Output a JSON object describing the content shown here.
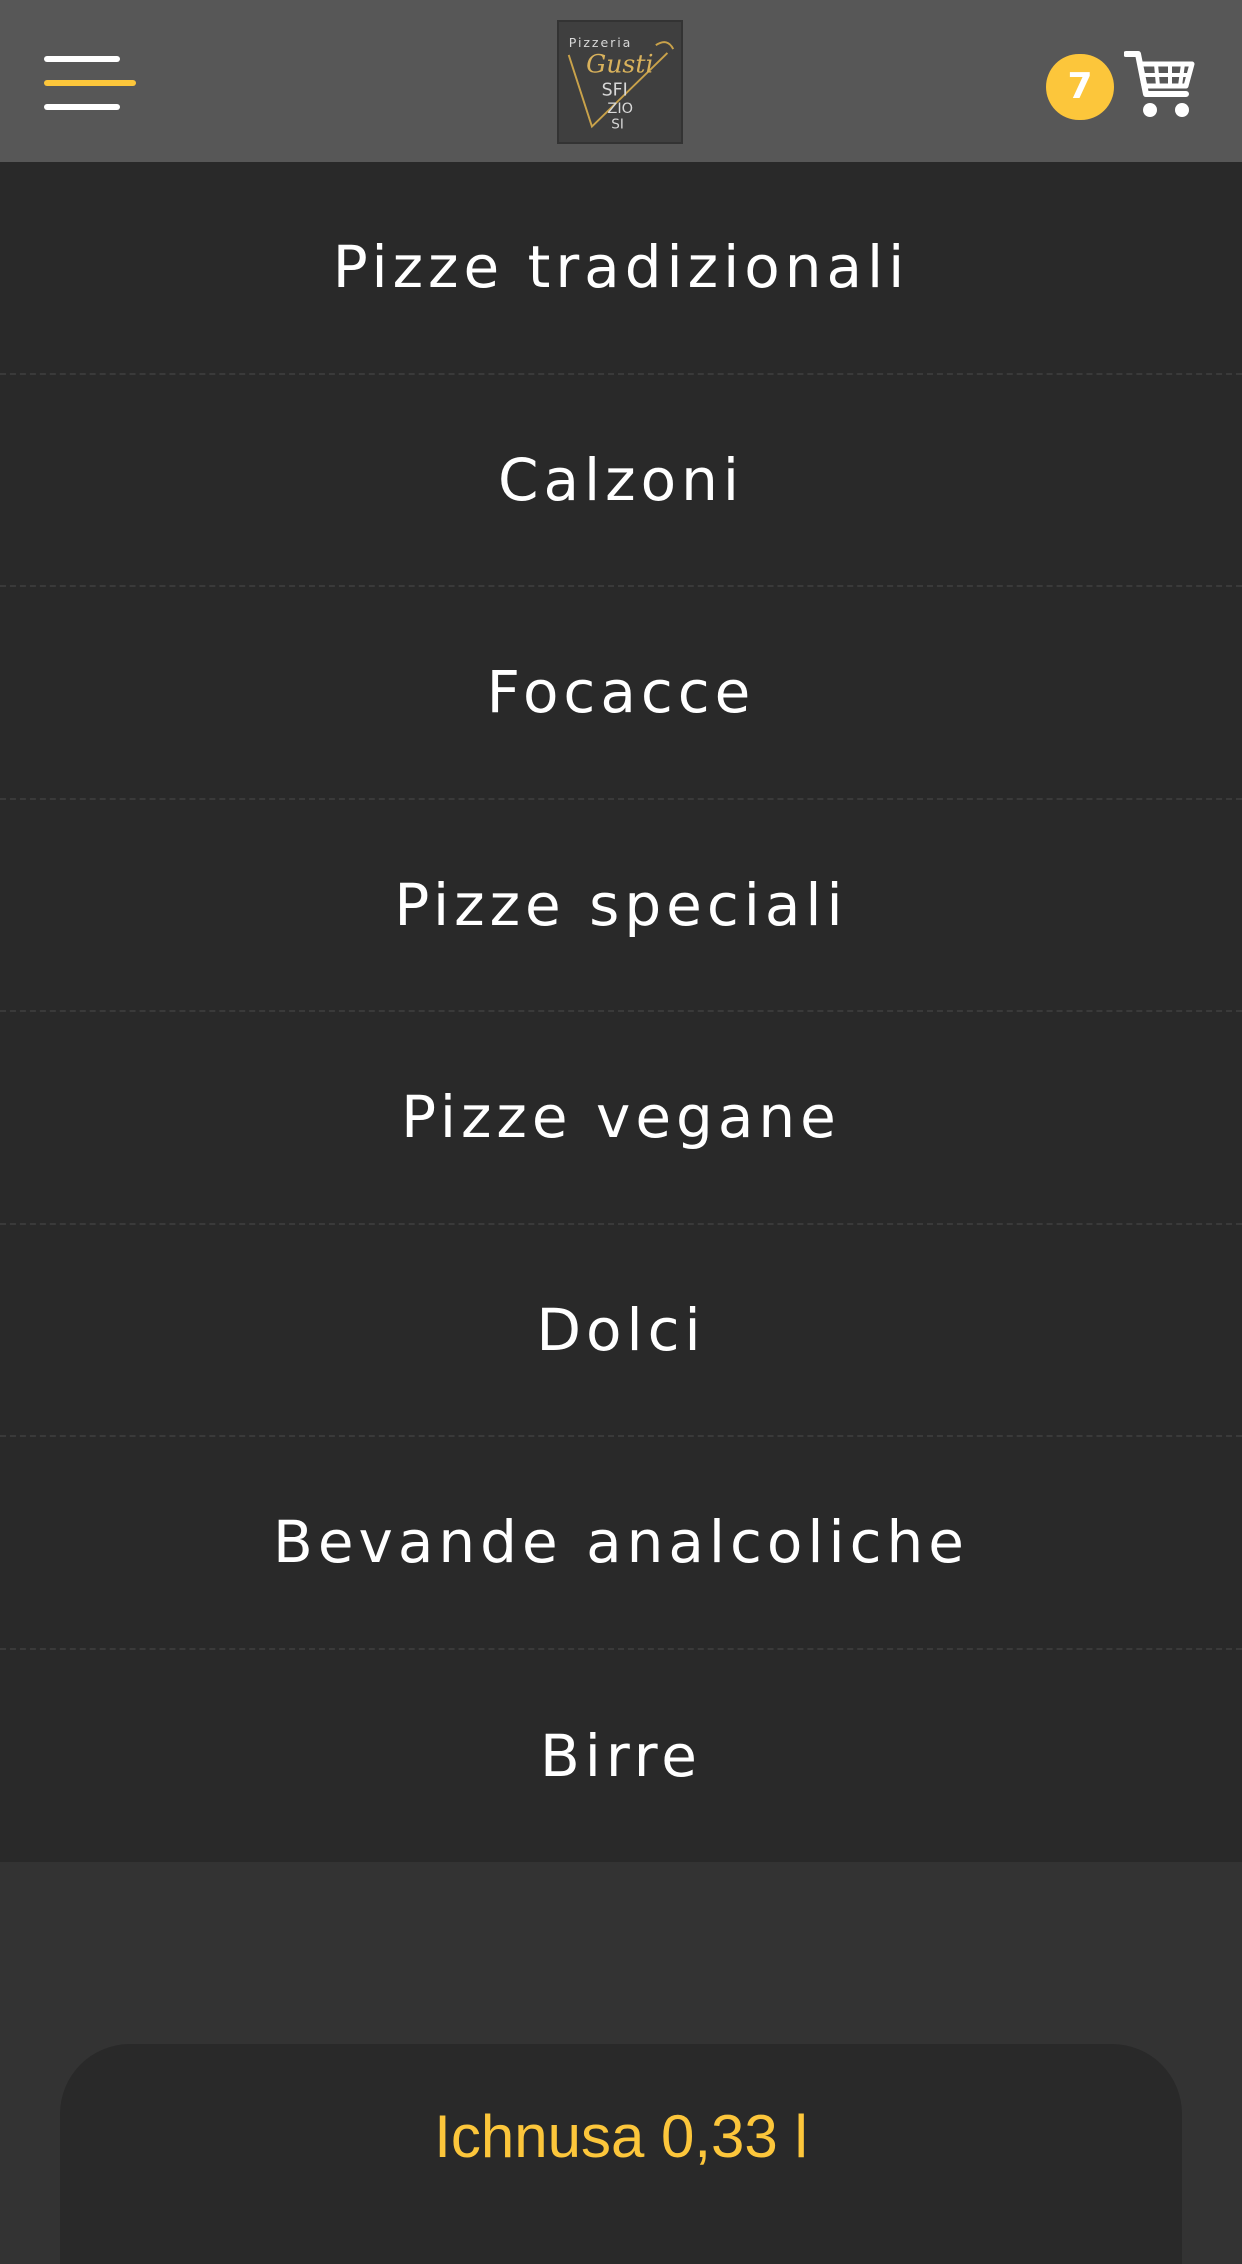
{
  "header": {
    "logo": {
      "top_text": "Pizzeria",
      "brand_text": "Gusti",
      "line1": "SFI",
      "line2": "ZIO",
      "line3": "SI"
    },
    "cart_count": "7"
  },
  "menu": {
    "items": [
      "Pizze tradizionali",
      "Calzoni",
      "Focacce",
      "Pizze speciali",
      "Pizze vegane",
      "Dolci",
      "Bevande analcoliche",
      "Birre"
    ]
  },
  "product": {
    "name": "Ichnusa 0,33 l"
  },
  "colors": {
    "accent": "#fcc63b",
    "header_bg": "#575757",
    "menu_bg": "#292929",
    "page_bg": "#333333"
  }
}
